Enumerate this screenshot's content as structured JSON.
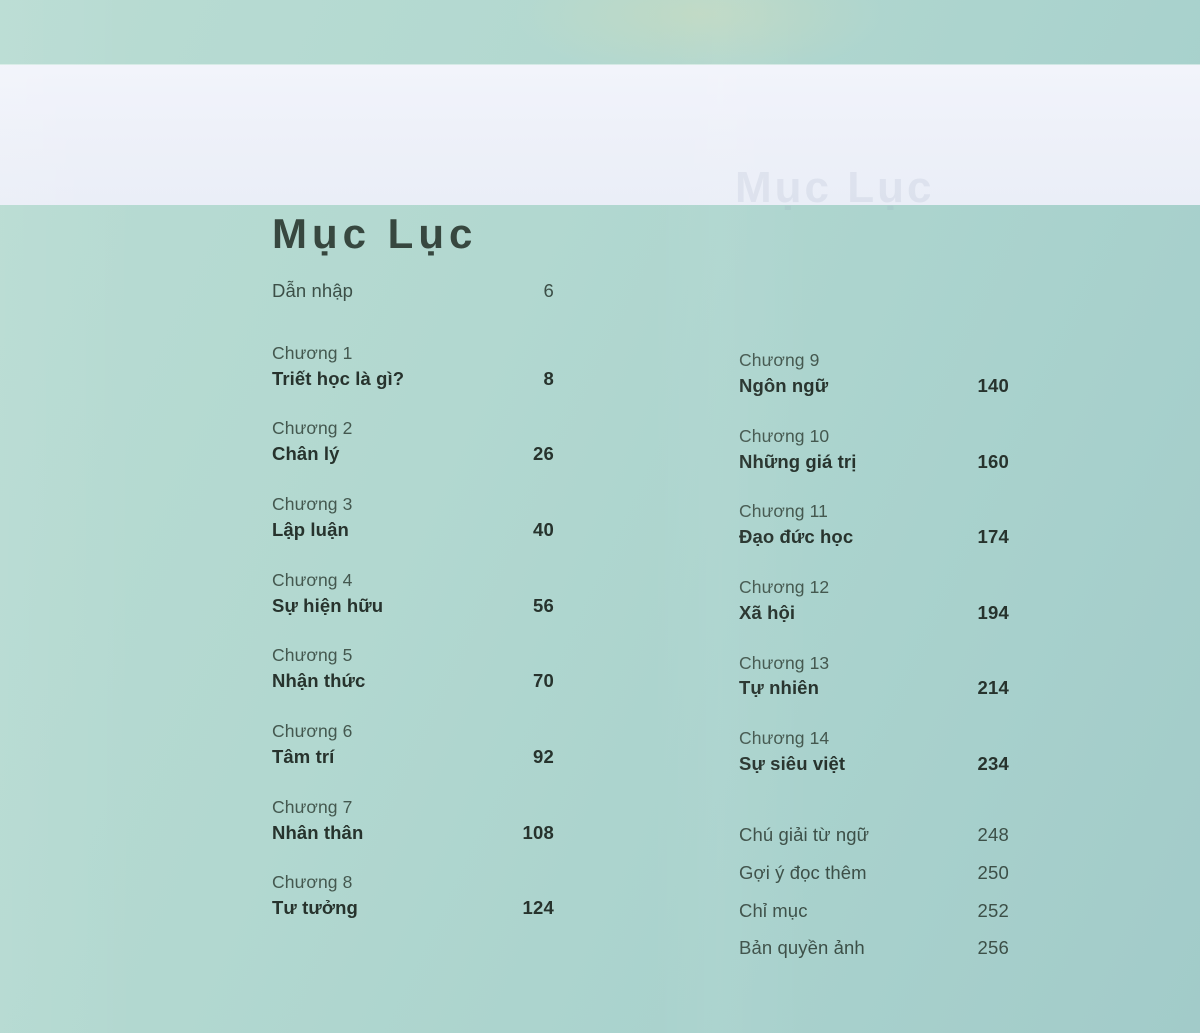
{
  "header": {
    "title": "Mục Lục",
    "ghost_text": "Mục Lục"
  },
  "toc": {
    "intro": {
      "title": "Dẫn nhập",
      "page": "6"
    },
    "left_chapters": [
      {
        "label": "Chương 1",
        "title": "Triết học là gì?",
        "page": "8"
      },
      {
        "label": "Chương 2",
        "title": "Chân lý",
        "page": "26"
      },
      {
        "label": "Chương 3",
        "title": "Lập luận",
        "page": "40"
      },
      {
        "label": "Chương 4",
        "title": "Sự hiện hữu",
        "page": "56"
      },
      {
        "label": "Chương 5",
        "title": "Nhận thức",
        "page": "70"
      },
      {
        "label": "Chương 6",
        "title": "Tâm trí",
        "page": "92"
      },
      {
        "label": "Chương 7",
        "title": "Nhân thân",
        "page": "108"
      },
      {
        "label": "Chương 8",
        "title": "Tư tưởng",
        "page": "124"
      }
    ],
    "right_chapters": [
      {
        "label": "Chương 9",
        "title": "Ngôn ngữ",
        "page": "140"
      },
      {
        "label": "Chương 10",
        "title": "Những giá trị",
        "page": "160"
      },
      {
        "label": "Chương 11",
        "title": "Đạo đức học",
        "page": "174"
      },
      {
        "label": "Chương 12",
        "title": "Xã hội",
        "page": "194"
      },
      {
        "label": "Chương 13",
        "title": "Tự nhiên",
        "page": "214"
      },
      {
        "label": "Chương 14",
        "title": "Sự siêu việt",
        "page": "234"
      }
    ],
    "back_matter": [
      {
        "title": "Chú giải từ ngữ",
        "page": "248"
      },
      {
        "title": "Gợi ý đọc thêm",
        "page": "250"
      },
      {
        "title": "Chỉ mục",
        "page": "252"
      },
      {
        "title": "Bản quyền ảnh",
        "page": "256"
      }
    ]
  },
  "colors": {
    "background": "#b2d8d0",
    "header_band": "#eef1f9",
    "title_text": "#37473f",
    "chapter_label": "#44584f",
    "entry_title": "#27332d"
  }
}
